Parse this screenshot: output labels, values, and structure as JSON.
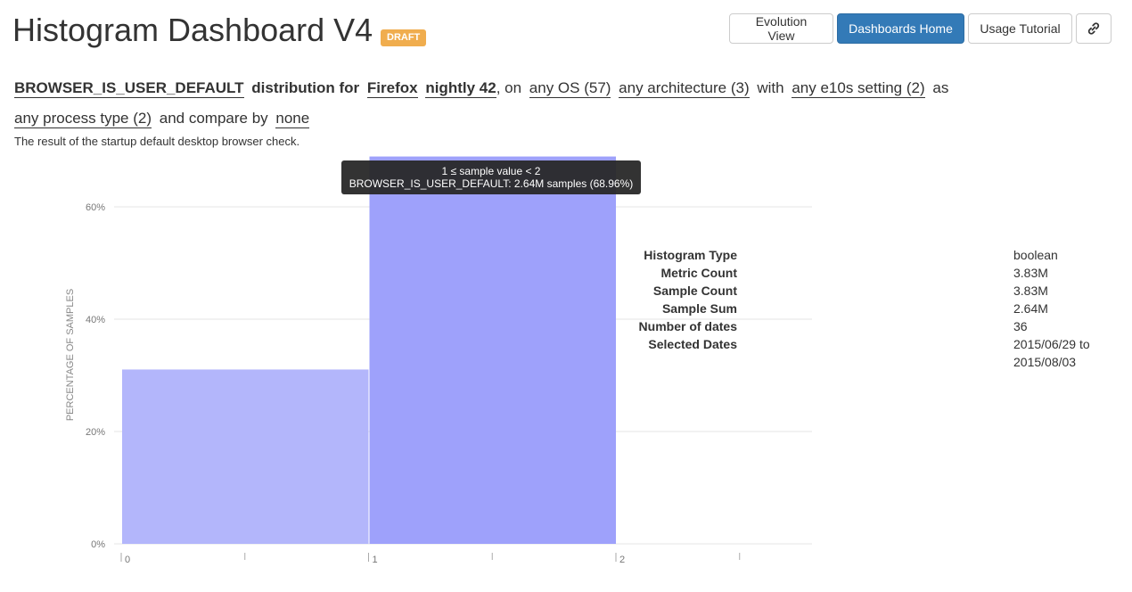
{
  "header": {
    "title": "Histogram Dashboard V4",
    "badge": "DRAFT",
    "buttons": {
      "evolution": "Evolution View",
      "home": "Dashboards Home",
      "tutorial": "Usage Tutorial"
    }
  },
  "query": {
    "metric": "BROWSER_IS_USER_DEFAULT",
    "t_distribution_for": "distribution for",
    "product": "Firefox",
    "channel_version": "nightly 42",
    "t_comma_on": ", on",
    "os": "any OS (57)",
    "architecture": "any architecture (3)",
    "t_with": "with",
    "e10s": "any e10s setting (2)",
    "t_as": "as",
    "process": "any process type (2)",
    "t_compare_by": "and compare by",
    "compare": "none"
  },
  "description": "The result of the startup default desktop browser check.",
  "tooltip": {
    "line1": "1 ≤ sample value < 2",
    "line2": "BROWSER_IS_USER_DEFAULT: 2.64M samples (68.96%)"
  },
  "chart_data": {
    "type": "bar",
    "ylabel": "PERCENTAGE OF SAMPLES",
    "ylim": [
      0,
      69
    ],
    "yticks": [
      "0%",
      "20%",
      "40%",
      "60%"
    ],
    "ytick_values": [
      0,
      20,
      40,
      60
    ],
    "bins": [
      {
        "from": 0,
        "to": 1,
        "value": 31.04,
        "color": "#b3b6fb"
      },
      {
        "from": 1,
        "to": 2,
        "value": 68.96,
        "color": "#9ea1fb"
      }
    ],
    "xtick_labels": [
      "0",
      "1",
      "2"
    ],
    "xtick_values": [
      0,
      1,
      2
    ],
    "xlim": [
      0,
      2.8
    ],
    "grid": true
  },
  "stats": [
    {
      "label": "Histogram Type",
      "value": "boolean"
    },
    {
      "label": "Metric Count",
      "value": "3.83M"
    },
    {
      "label": "Sample Count",
      "value": "3.83M"
    },
    {
      "label": "Sample Sum",
      "value": "2.64M"
    },
    {
      "label": "Number of dates",
      "value": "36"
    },
    {
      "label": "Selected Dates",
      "value": "2015/06/29 to",
      "value2": "2015/08/03"
    }
  ]
}
